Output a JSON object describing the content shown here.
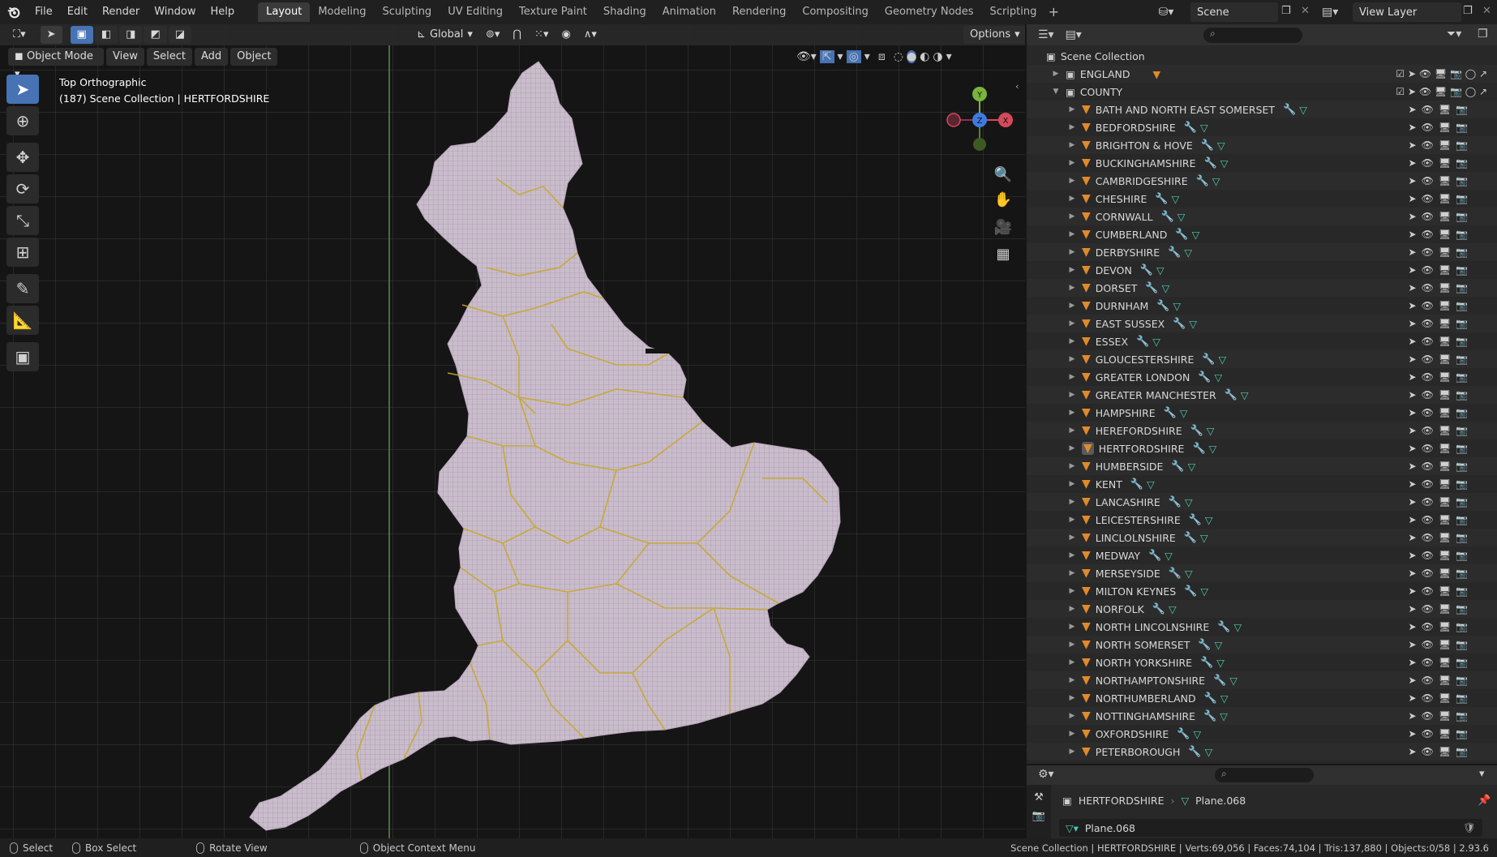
{
  "menubar": {
    "items": [
      "File",
      "Edit",
      "Render",
      "Window",
      "Help"
    ],
    "workspaces": [
      "Layout",
      "Modeling",
      "Sculpting",
      "UV Editing",
      "Texture Paint",
      "Shading",
      "Animation",
      "Rendering",
      "Compositing",
      "Geometry Nodes",
      "Scripting"
    ],
    "active_workspace": "Layout",
    "scene_name": "Scene",
    "view_layer": "View Layer"
  },
  "viewport": {
    "mode": "Object Mode",
    "menus": [
      "View",
      "Select",
      "Add",
      "Object"
    ],
    "transform_orientation": "Global",
    "options_label": "Options",
    "view_name": "Top Orthographic",
    "view_info": "(187) Scene Collection | HERTFORDSHIRE",
    "gizmo_labels": {
      "x": "X",
      "y": "Y",
      "z": "Z"
    }
  },
  "outliner": {
    "root": "Scene Collection",
    "collections": [
      {
        "name": "ENGLAND",
        "expanded": false
      },
      {
        "name": "COUNTY",
        "expanded": true
      }
    ],
    "objects": [
      "BATH AND NORTH EAST SOMERSET",
      "BEDFORDSHIRE",
      "BRIGHTON & HOVE",
      "BUCKINGHAMSHIRE",
      "CAMBRIDGESHIRE",
      "CHESHIRE",
      "CORNWALL",
      "CUMBERLAND",
      "DERBYSHIRE",
      "DEVON",
      "DORSET",
      "DURNHAM",
      "EAST SUSSEX",
      "ESSEX",
      "GLOUCESTERSHIRE",
      "GREATER LONDON",
      "GREATER MANCHESTER",
      "HAMPSHIRE",
      "HEREFORDSHIRE",
      "HERTFORDSHIRE",
      "HUMBERSIDE",
      "KENT",
      "LANCASHIRE",
      "LEICESTERSHIRE",
      "LINCLOLNSHIRE",
      "MEDWAY",
      "MERSEYSIDE",
      "MILTON KEYNES",
      "NORFOLK",
      "NORTH LINCOLNSHIRE",
      "NORTH SOMERSET",
      "NORTH YORKSHIRE",
      "NORTHAMPTONSHIRE",
      "NORTHUMBERLAND",
      "NOTTINGHAMSHIRE",
      "OXFORDSHIRE",
      "PETERBOROUGH"
    ],
    "selected": "HERTFORDSHIRE",
    "accent_color": "#e08a2c",
    "data_color": "#4ec9b0"
  },
  "properties": {
    "object_name": "HERTFORDSHIRE",
    "mesh_name": "Plane.068",
    "data_field": "Plane.068"
  },
  "statusbar": {
    "select": "Select",
    "box_select": "Box Select",
    "rotate": "Rotate View",
    "context": "Object Context Menu",
    "stats": "Scene Collection | HERTFORDSHIRE | Verts:69,056 | Faces:74,104 | Tris:137,880 | Objects:0/58 | 2.93.6"
  },
  "colors": {
    "accent_blue": "#4772b3",
    "mesh_fill": "#c7b9c9",
    "border_yellow": "#c8a82a"
  }
}
